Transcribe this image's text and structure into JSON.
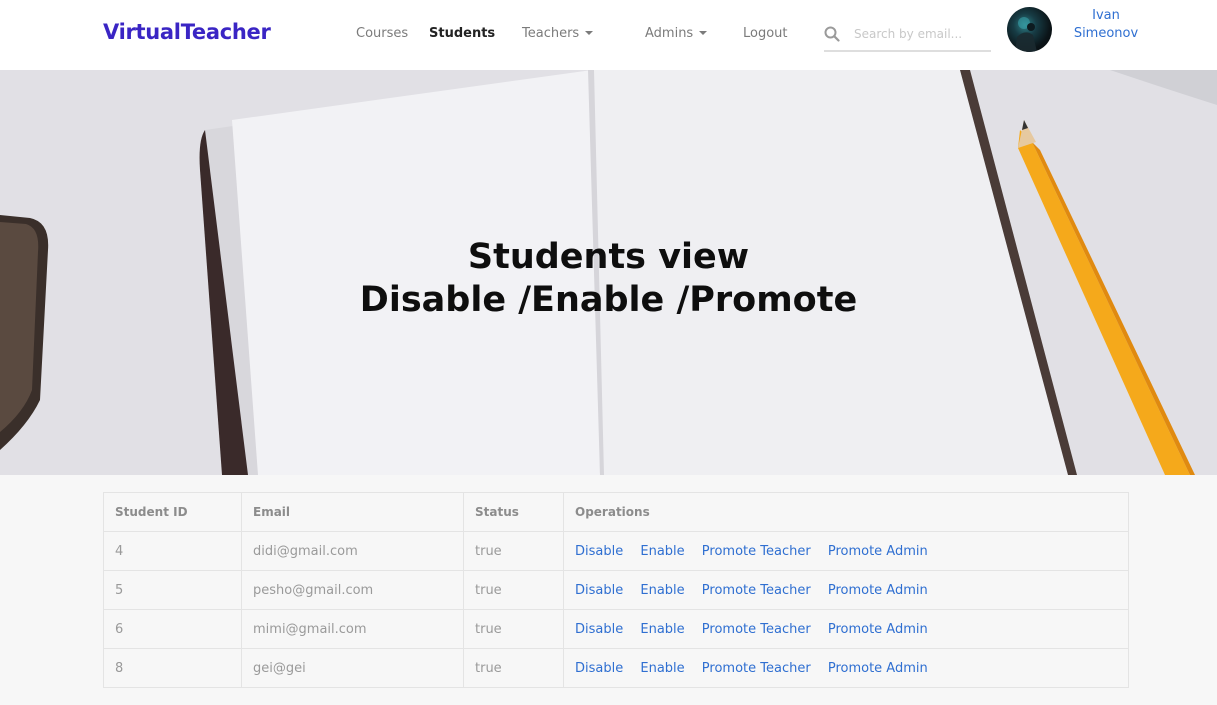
{
  "brand": "VirtualTeacher",
  "nav": {
    "courses": "Courses",
    "students": "Students",
    "teachers": "Teachers",
    "admins": "Admins",
    "logout": "Logout"
  },
  "search": {
    "placeholder": "Search by email..."
  },
  "user": {
    "first_name": "Ivan",
    "last_name": "Simeonov"
  },
  "hero": {
    "line1": "Students view",
    "line2": "Disable /Enable /Promote"
  },
  "table": {
    "headers": [
      "Student ID",
      "Email",
      "Status",
      "Operations"
    ],
    "rows": [
      {
        "id": "4",
        "email": "didi@gmail.com",
        "status": "true"
      },
      {
        "id": "5",
        "email": "pesho@gmail.com",
        "status": "true"
      },
      {
        "id": "6",
        "email": "mimi@gmail.com",
        "status": "true"
      },
      {
        "id": "8",
        "email": "gei@gei",
        "status": "true"
      }
    ],
    "operations": {
      "disable": "Disable",
      "enable": "Enable",
      "promote_teacher": "Promote Teacher",
      "promote_admin": "Promote Admin"
    }
  },
  "colors": {
    "brand": "#3a25c4",
    "link": "#2f6fd1",
    "pencil": "#f5a91b"
  }
}
